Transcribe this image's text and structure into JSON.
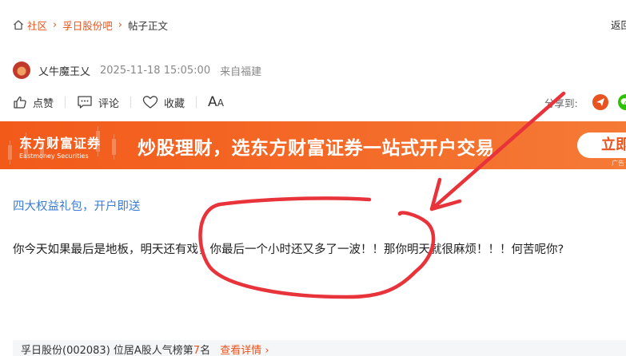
{
  "breadcrumb": {
    "community": "社区",
    "stock_bar": "孚日股份吧",
    "current": "帖子正文",
    "back": "返回"
  },
  "post": {
    "author": "乂牛魔王乂",
    "time": "2025-11-18 15:05:00",
    "location": "来自福建",
    "promo_link": "四大权益礼包，开户即送",
    "content": "你今天如果最后是地板，明天还有戏，你最后一个小时还又多了一波！！那你明天就很麻烦！！！何苦呢你?"
  },
  "actions": {
    "like": "点赞",
    "comment": "评论",
    "favorite": "收藏",
    "font_big": "A",
    "font_small": "A",
    "share_label": "分享到:"
  },
  "banner": {
    "logo_cn": "东方财富证券",
    "logo_en": "Eastmoney Securities",
    "slogan": "炒股理财，选东方财富证券一站式开户交易",
    "cta": "立即",
    "ad_tag": "广告"
  },
  "rank_bar": {
    "prefix": "孚日股份(002083) 位居A股人气榜第",
    "rank": "7",
    "suffix": "名",
    "more": "查看详情"
  },
  "colors": {
    "accent": "#e8541e",
    "link": "#3b7bd4",
    "annotation": "#e8333a"
  },
  "icons": [
    "home-icon",
    "like-icon",
    "comment-icon",
    "heart-icon",
    "share-red-icon",
    "wechat-icon",
    "chevron-right-icon"
  ]
}
